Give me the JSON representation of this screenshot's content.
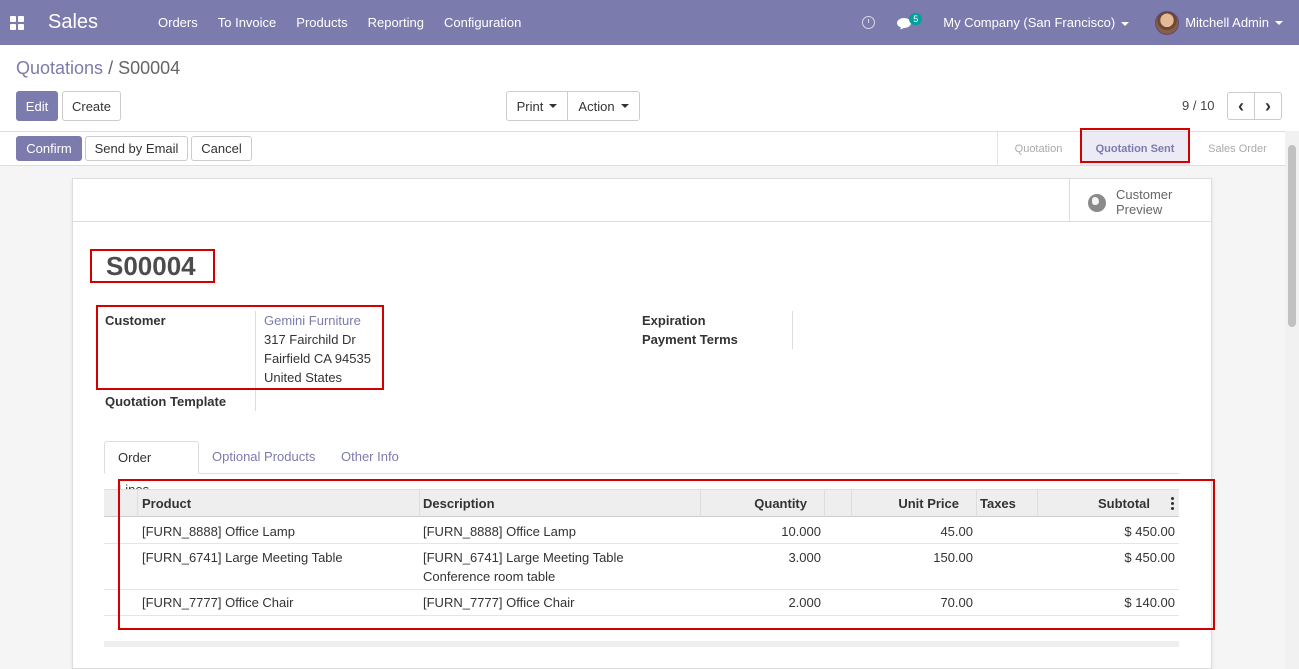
{
  "navbar": {
    "app_name": "Sales",
    "menu": [
      "Orders",
      "To Invoice",
      "Products",
      "Reporting",
      "Configuration"
    ],
    "messages_count": "5",
    "company": "My Company (San Francisco)",
    "user": "Mitchell Admin",
    "accent_color": "#7c7bad"
  },
  "breadcrumb": {
    "parent": "Quotations",
    "separator": "/",
    "current": "S00004"
  },
  "toolbar": {
    "edit": "Edit",
    "create": "Create",
    "print": "Print",
    "action": "Action",
    "pager": "9 / 10"
  },
  "statusbar": {
    "confirm": "Confirm",
    "send_email": "Send by Email",
    "cancel": "Cancel",
    "stages": [
      "Quotation",
      "Quotation Sent",
      "Sales Order"
    ],
    "active_stage": "Quotation Sent"
  },
  "form": {
    "customer_preview": "Customer Preview",
    "name": "S00004",
    "customer_label": "Customer",
    "customer_name": "Gemini Furniture",
    "address_line1": "317 Fairchild Dr",
    "address_line2": "Fairfield CA 94535",
    "address_line3": "United States",
    "template_label": "Quotation Template",
    "expiration_label": "Expiration",
    "payment_terms_label": "Payment Terms"
  },
  "tabs": [
    "Order Lines",
    "Optional Products",
    "Other Info"
  ],
  "order_lines": {
    "columns": [
      "Product",
      "Description",
      "Quantity",
      "Unit Price",
      "Taxes",
      "Subtotal"
    ],
    "rows": [
      {
        "product": "[FURN_8888] Office Lamp",
        "description": "[FURN_8888] Office Lamp",
        "description2": "",
        "quantity": "10.000",
        "unit_price": "45.00",
        "taxes": "",
        "subtotal": "$ 450.00"
      },
      {
        "product": "[FURN_6741] Large Meeting Table",
        "description": "[FURN_6741] Large Meeting Table",
        "description2": "Conference room table",
        "quantity": "3.000",
        "unit_price": "150.00",
        "taxes": "",
        "subtotal": "$ 450.00"
      },
      {
        "product": "[FURN_7777] Office Chair",
        "description": "[FURN_7777] Office Chair",
        "description2": "",
        "quantity": "2.000",
        "unit_price": "70.00",
        "taxes": "",
        "subtotal": "$ 140.00"
      }
    ]
  }
}
